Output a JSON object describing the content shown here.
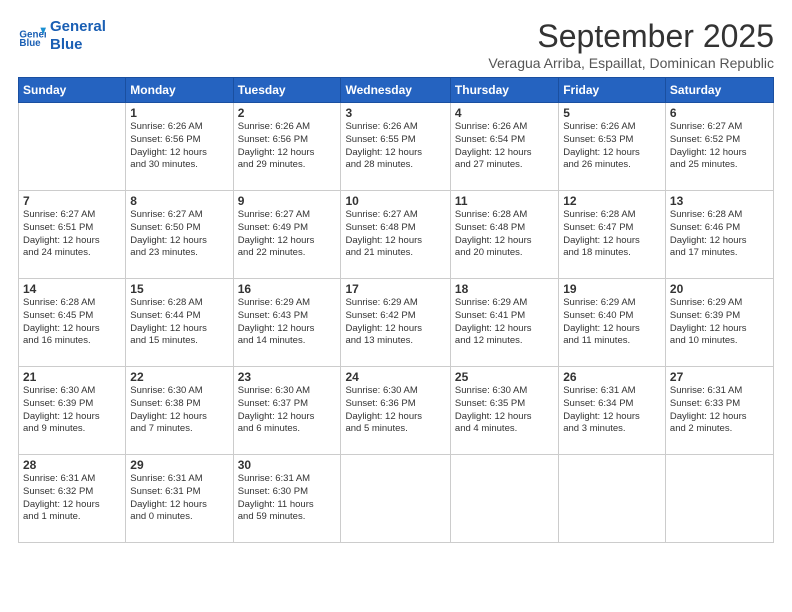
{
  "logo": {
    "line1": "General",
    "line2": "Blue"
  },
  "title": "September 2025",
  "subtitle": "Veragua Arriba, Espaillat, Dominican Republic",
  "days_header": [
    "Sunday",
    "Monday",
    "Tuesday",
    "Wednesday",
    "Thursday",
    "Friday",
    "Saturday"
  ],
  "weeks": [
    [
      {
        "day": "",
        "info": ""
      },
      {
        "day": "1",
        "info": "Sunrise: 6:26 AM\nSunset: 6:56 PM\nDaylight: 12 hours\nand 30 minutes."
      },
      {
        "day": "2",
        "info": "Sunrise: 6:26 AM\nSunset: 6:56 PM\nDaylight: 12 hours\nand 29 minutes."
      },
      {
        "day": "3",
        "info": "Sunrise: 6:26 AM\nSunset: 6:55 PM\nDaylight: 12 hours\nand 28 minutes."
      },
      {
        "day": "4",
        "info": "Sunrise: 6:26 AM\nSunset: 6:54 PM\nDaylight: 12 hours\nand 27 minutes."
      },
      {
        "day": "5",
        "info": "Sunrise: 6:26 AM\nSunset: 6:53 PM\nDaylight: 12 hours\nand 26 minutes."
      },
      {
        "day": "6",
        "info": "Sunrise: 6:27 AM\nSunset: 6:52 PM\nDaylight: 12 hours\nand 25 minutes."
      }
    ],
    [
      {
        "day": "7",
        "info": "Sunrise: 6:27 AM\nSunset: 6:51 PM\nDaylight: 12 hours\nand 24 minutes."
      },
      {
        "day": "8",
        "info": "Sunrise: 6:27 AM\nSunset: 6:50 PM\nDaylight: 12 hours\nand 23 minutes."
      },
      {
        "day": "9",
        "info": "Sunrise: 6:27 AM\nSunset: 6:49 PM\nDaylight: 12 hours\nand 22 minutes."
      },
      {
        "day": "10",
        "info": "Sunrise: 6:27 AM\nSunset: 6:48 PM\nDaylight: 12 hours\nand 21 minutes."
      },
      {
        "day": "11",
        "info": "Sunrise: 6:28 AM\nSunset: 6:48 PM\nDaylight: 12 hours\nand 20 minutes."
      },
      {
        "day": "12",
        "info": "Sunrise: 6:28 AM\nSunset: 6:47 PM\nDaylight: 12 hours\nand 18 minutes."
      },
      {
        "day": "13",
        "info": "Sunrise: 6:28 AM\nSunset: 6:46 PM\nDaylight: 12 hours\nand 17 minutes."
      }
    ],
    [
      {
        "day": "14",
        "info": "Sunrise: 6:28 AM\nSunset: 6:45 PM\nDaylight: 12 hours\nand 16 minutes."
      },
      {
        "day": "15",
        "info": "Sunrise: 6:28 AM\nSunset: 6:44 PM\nDaylight: 12 hours\nand 15 minutes."
      },
      {
        "day": "16",
        "info": "Sunrise: 6:29 AM\nSunset: 6:43 PM\nDaylight: 12 hours\nand 14 minutes."
      },
      {
        "day": "17",
        "info": "Sunrise: 6:29 AM\nSunset: 6:42 PM\nDaylight: 12 hours\nand 13 minutes."
      },
      {
        "day": "18",
        "info": "Sunrise: 6:29 AM\nSunset: 6:41 PM\nDaylight: 12 hours\nand 12 minutes."
      },
      {
        "day": "19",
        "info": "Sunrise: 6:29 AM\nSunset: 6:40 PM\nDaylight: 12 hours\nand 11 minutes."
      },
      {
        "day": "20",
        "info": "Sunrise: 6:29 AM\nSunset: 6:39 PM\nDaylight: 12 hours\nand 10 minutes."
      }
    ],
    [
      {
        "day": "21",
        "info": "Sunrise: 6:30 AM\nSunset: 6:39 PM\nDaylight: 12 hours\nand 9 minutes."
      },
      {
        "day": "22",
        "info": "Sunrise: 6:30 AM\nSunset: 6:38 PM\nDaylight: 12 hours\nand 7 minutes."
      },
      {
        "day": "23",
        "info": "Sunrise: 6:30 AM\nSunset: 6:37 PM\nDaylight: 12 hours\nand 6 minutes."
      },
      {
        "day": "24",
        "info": "Sunrise: 6:30 AM\nSunset: 6:36 PM\nDaylight: 12 hours\nand 5 minutes."
      },
      {
        "day": "25",
        "info": "Sunrise: 6:30 AM\nSunset: 6:35 PM\nDaylight: 12 hours\nand 4 minutes."
      },
      {
        "day": "26",
        "info": "Sunrise: 6:31 AM\nSunset: 6:34 PM\nDaylight: 12 hours\nand 3 minutes."
      },
      {
        "day": "27",
        "info": "Sunrise: 6:31 AM\nSunset: 6:33 PM\nDaylight: 12 hours\nand 2 minutes."
      }
    ],
    [
      {
        "day": "28",
        "info": "Sunrise: 6:31 AM\nSunset: 6:32 PM\nDaylight: 12 hours\nand 1 minute."
      },
      {
        "day": "29",
        "info": "Sunrise: 6:31 AM\nSunset: 6:31 PM\nDaylight: 12 hours\nand 0 minutes."
      },
      {
        "day": "30",
        "info": "Sunrise: 6:31 AM\nSunset: 6:30 PM\nDaylight: 11 hours\nand 59 minutes."
      },
      {
        "day": "",
        "info": ""
      },
      {
        "day": "",
        "info": ""
      },
      {
        "day": "",
        "info": ""
      },
      {
        "day": "",
        "info": ""
      }
    ]
  ]
}
